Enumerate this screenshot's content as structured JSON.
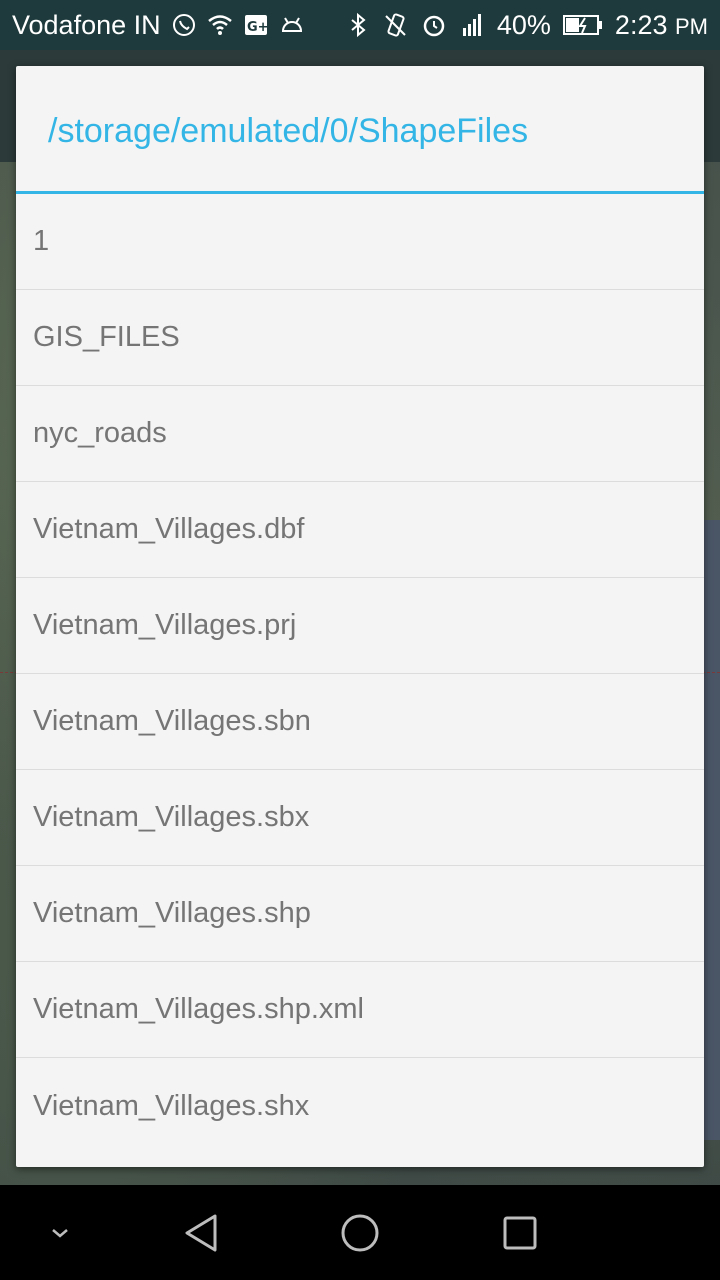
{
  "status_bar": {
    "carrier": "Vodafone IN",
    "battery": "40%",
    "time": "2:23",
    "ampm": "PM",
    "icons": [
      "whatsapp-icon",
      "wifi-icon",
      "google-plus-icon",
      "android-icon",
      "bluetooth-icon",
      "vibrate-icon",
      "alarm-icon",
      "signal-icon",
      "battery-icon"
    ]
  },
  "dialog": {
    "title": "/storage/emulated/0/ShapeFiles",
    "accent_color": "#33b5e5",
    "items": [
      {
        "label": "1"
      },
      {
        "label": "GIS_FILES"
      },
      {
        "label": "nyc_roads"
      },
      {
        "label": "Vietnam_Villages.dbf"
      },
      {
        "label": "Vietnam_Villages.prj"
      },
      {
        "label": "Vietnam_Villages.sbn"
      },
      {
        "label": "Vietnam_Villages.sbx"
      },
      {
        "label": "Vietnam_Villages.shp"
      },
      {
        "label": "Vietnam_Villages.shp.xml"
      },
      {
        "label": "Vietnam_Villages.shx"
      }
    ]
  },
  "nav_bar": {
    "icons": [
      "hide-keyboard-chevron-icon",
      "back-icon",
      "home-icon",
      "recents-icon"
    ]
  }
}
